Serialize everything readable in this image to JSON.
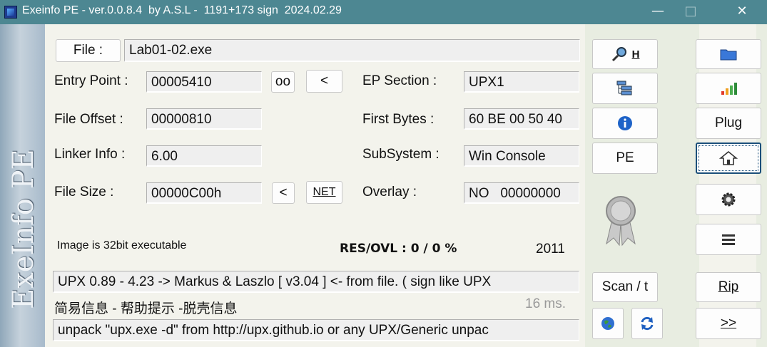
{
  "window": {
    "title": "Exeinfo PE - ver.0.0.8.4  by A.S.L -  1191+173 sign  2024.02.29",
    "sidebar_text": "ExeInfo PE"
  },
  "file": {
    "button_label": "File :",
    "path": "Lab01-02.exe"
  },
  "fields": {
    "entry_point_label": "Entry Point :",
    "entry_point_value": "00005410",
    "oo_button": "oo",
    "ep_back_button": "<",
    "ep_section_label": "EP Section :",
    "ep_section_value": "UPX1",
    "file_offset_label": "File Offset :",
    "file_offset_value": "00000810",
    "first_bytes_label": "First Bytes :",
    "first_bytes_value": "60 BE 00 50 40",
    "linker_label": "Linker Info :",
    "linker_value": "6.00",
    "subsystem_label": "SubSystem :",
    "subsystem_value": "Win Console",
    "file_size_label": "File Size :",
    "file_size_value": "00000C00h",
    "fs_back_button": "<",
    "net_button": "NET",
    "overlay_label": "Overlay :",
    "overlay_value": "NO   00000000"
  },
  "status": {
    "image_info": "Image is 32bit executable",
    "res_ovl": "RES/OVL : 0 / 0 %",
    "year": "2011",
    "detect": "UPX 0.89 - 4.23 -> Markus & Laszlo [ v3.04 ] <- from file. ( sign like UPX",
    "links": "简易信息 - 帮助提示 -脱壳信息",
    "time": "16 ms.",
    "hint": "unpack \"upx.exe -d\"  from  http://upx.github.io or any UPX/Generic unpac"
  },
  "mid_buttons": {
    "h_label": "H",
    "pe_label": "PE",
    "scan_label": "Scan / t"
  },
  "right_buttons": {
    "plug_label": "Plug",
    "rip_label": "Rip",
    "next_label": ">>"
  },
  "colors": {
    "titlebar": "#4d8792",
    "selected_border": "#1b4f7a"
  }
}
